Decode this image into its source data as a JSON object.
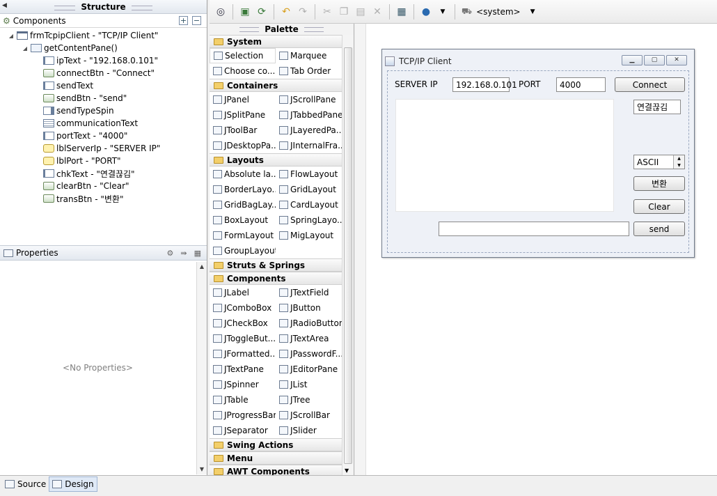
{
  "structure": {
    "title": "Structure",
    "components_label": "Components",
    "tree": [
      {
        "label": "frmTcpipClient - \"TCP/IP Client\"",
        "icon": "frame"
      },
      {
        "label": "getContentPane()",
        "icon": "pane"
      },
      {
        "label": "ipText - \"192.168.0.101\"",
        "icon": "txt"
      },
      {
        "label": "connectBtn - \"Connect\"",
        "icon": "btn"
      },
      {
        "label": "sendText",
        "icon": "txt"
      },
      {
        "label": "sendBtn - \"send\"",
        "icon": "btn"
      },
      {
        "label": "sendTypeSpin",
        "icon": "spin"
      },
      {
        "label": "communicationText",
        "icon": "area"
      },
      {
        "label": "portText - \"4000\"",
        "icon": "txt"
      },
      {
        "label": "lblServerIp - \"SERVER IP\"",
        "icon": "lbl"
      },
      {
        "label": "lblPort - \"PORT\"",
        "icon": "lbl"
      },
      {
        "label": "chkText - \"연결끊김\"",
        "icon": "txt"
      },
      {
        "label": "clearBtn - \"Clear\"",
        "icon": "btn"
      },
      {
        "label": "transBtn - \"변환\"",
        "icon": "btn"
      }
    ]
  },
  "properties": {
    "title": "Properties",
    "empty_text": "<No Properties>"
  },
  "toolbar": {
    "system_select": "<system>"
  },
  "palette": {
    "title": "Palette",
    "categories": [
      {
        "name": "System",
        "rows": [
          [
            "Selection",
            "Marquee"
          ],
          [
            "Choose co...",
            "Tab Order"
          ]
        ]
      },
      {
        "name": "Containers",
        "rows": [
          [
            "JPanel",
            "JScrollPane"
          ],
          [
            "JSplitPane",
            "JTabbedPane"
          ],
          [
            "JToolBar",
            "JLayeredPa..."
          ],
          [
            "JDesktopPa...",
            "JInternalFra..."
          ]
        ]
      },
      {
        "name": "Layouts",
        "rows": [
          [
            "Absolute la...",
            "FlowLayout"
          ],
          [
            "BorderLayo...",
            "GridLayout"
          ],
          [
            "GridBagLay...",
            "CardLayout"
          ],
          [
            "BoxLayout",
            "SpringLayo..."
          ],
          [
            "FormLayout",
            "MigLayout"
          ],
          [
            "GroupLayout",
            ""
          ]
        ]
      },
      {
        "name": "Struts & Springs",
        "rows": []
      },
      {
        "name": "Components",
        "rows": [
          [
            "JLabel",
            "JTextField"
          ],
          [
            "JComboBox",
            "JButton"
          ],
          [
            "JCheckBox",
            "JRadioButton"
          ],
          [
            "JToggleBut...",
            "JTextArea"
          ],
          [
            "JFormatted...",
            "JPasswordF..."
          ],
          [
            "JTextPane",
            "JEditorPane"
          ],
          [
            "JSpinner",
            "JList"
          ],
          [
            "JTable",
            "JTree"
          ],
          [
            "JProgressBar",
            "JScrollBar"
          ],
          [
            "JSeparator",
            "JSlider"
          ]
        ]
      },
      {
        "name": "Swing Actions",
        "rows": []
      },
      {
        "name": "Menu",
        "rows": []
      },
      {
        "name": "AWT Components",
        "rows": []
      }
    ]
  },
  "frame": {
    "title": "TCP/IP Client",
    "server_ip_label": "SERVER IP",
    "ip_value": "192.168.0.101",
    "port_label": "PORT",
    "port_value": "4000",
    "connect_label": "Connect",
    "status_value": "연결끊김",
    "spin_value": "ASCII",
    "trans_label": "변환",
    "clear_label": "Clear",
    "send_label": "send",
    "send_value": ""
  },
  "tabs": {
    "source": "Source",
    "design": "Design"
  }
}
